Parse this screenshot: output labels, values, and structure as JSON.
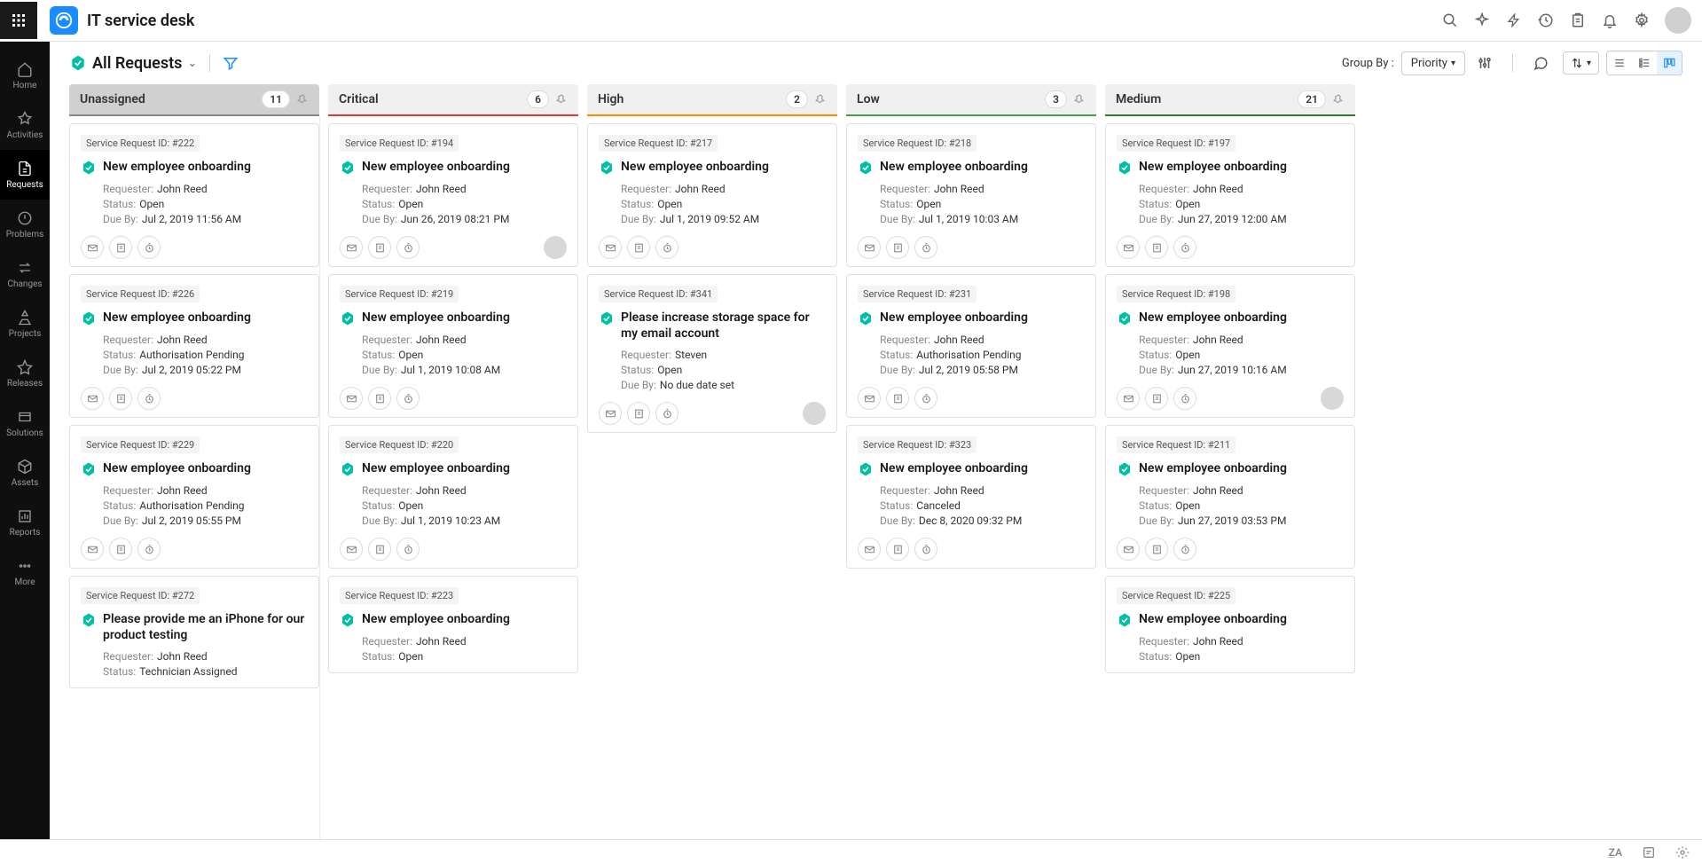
{
  "app_title": "IT service desk",
  "nav": [
    {
      "label": "Home"
    },
    {
      "label": "Activities"
    },
    {
      "label": "Requests"
    },
    {
      "label": "Problems"
    },
    {
      "label": "Changes"
    },
    {
      "label": "Projects"
    },
    {
      "label": "Releases"
    },
    {
      "label": "Solutions"
    },
    {
      "label": "Assets"
    },
    {
      "label": "Reports"
    },
    {
      "label": "More"
    }
  ],
  "active_nav": 2,
  "toolbar": {
    "view_title": "All Requests",
    "group_by_label": "Group By :",
    "group_by_value": "Priority"
  },
  "labels": {
    "id_prefix": "Service Request ID: #",
    "requester": "Requester:",
    "status": "Status:",
    "due_by": "Due By:"
  },
  "columns": [
    {
      "key": "unassigned",
      "title": "Unassigned",
      "count": "11",
      "cls": "col-unassigned",
      "cards": [
        {
          "id": "222",
          "title": "New employee onboarding",
          "requester": "John Reed",
          "status": "Open",
          "due": "Jul 2, 2019 11:56 AM",
          "assignee": false
        },
        {
          "id": "226",
          "title": "New employee onboarding",
          "requester": "John Reed",
          "status": "Authorisation Pending",
          "due": "Jul 2, 2019 05:22 PM",
          "assignee": false
        },
        {
          "id": "229",
          "title": "New employee onboarding",
          "requester": "John Reed",
          "status": "Authorisation Pending",
          "due": "Jul 2, 2019 05:55 PM",
          "assignee": false
        },
        {
          "id": "272",
          "title": "Please provide me an iPhone for our product testing",
          "requester": "John Reed",
          "status": "Technician Assigned",
          "due": "",
          "assignee": false,
          "partial": true
        }
      ]
    },
    {
      "key": "critical",
      "title": "Critical",
      "count": "6",
      "cls": "col-critical",
      "cards": [
        {
          "id": "194",
          "title": "New employee onboarding",
          "requester": "John Reed",
          "status": "Open",
          "due": "Jun 26, 2019 08:21 PM",
          "assignee": true
        },
        {
          "id": "219",
          "title": "New employee onboarding",
          "requester": "John Reed",
          "status": "Open",
          "due": "Jul 1, 2019 10:08 AM",
          "assignee": false
        },
        {
          "id": "220",
          "title": "New employee onboarding",
          "requester": "John Reed",
          "status": "Open",
          "due": "Jul 1, 2019 10:23 AM",
          "assignee": false
        },
        {
          "id": "223",
          "title": "New employee onboarding",
          "requester": "John Reed",
          "status": "Open",
          "due": "",
          "assignee": false,
          "partial": true
        }
      ]
    },
    {
      "key": "high",
      "title": "High",
      "count": "2",
      "cls": "col-high",
      "cards": [
        {
          "id": "217",
          "title": "New employee onboarding",
          "requester": "John Reed",
          "status": "Open",
          "due": "Jul 1, 2019 09:52 AM",
          "assignee": false
        },
        {
          "id": "341",
          "title": "Please increase storage space for my email account",
          "requester": "Steven",
          "status": "Open",
          "due": "No due date set",
          "assignee": true
        }
      ]
    },
    {
      "key": "low",
      "title": "Low",
      "count": "3",
      "cls": "col-low",
      "cards": [
        {
          "id": "218",
          "title": "New employee onboarding",
          "requester": "John Reed",
          "status": "Open",
          "due": "Jul 1, 2019 10:03 AM",
          "assignee": false
        },
        {
          "id": "231",
          "title": "New employee onboarding",
          "requester": "John Reed",
          "status": "Authorisation Pending",
          "due": "Jul 2, 2019 05:58 PM",
          "assignee": false
        },
        {
          "id": "323",
          "title": "New employee onboarding",
          "requester": "John Reed",
          "status": "Canceled",
          "due": "Dec 8, 2020 09:32 PM",
          "assignee": false
        }
      ]
    },
    {
      "key": "medium",
      "title": "Medium",
      "count": "21",
      "cls": "col-medium",
      "cards": [
        {
          "id": "197",
          "title": "New employee onboarding",
          "requester": "John Reed",
          "status": "Open",
          "due": "Jun 27, 2019 12:00 AM",
          "assignee": false
        },
        {
          "id": "198",
          "title": "New employee onboarding",
          "requester": "John Reed",
          "status": "Open",
          "due": "Jun 27, 2019 10:16 AM",
          "assignee": true
        },
        {
          "id": "211",
          "title": "New employee onboarding",
          "requester": "John Reed",
          "status": "Open",
          "due": "Jun 27, 2019 03:53 PM",
          "assignee": false
        },
        {
          "id": "225",
          "title": "New employee onboarding",
          "requester": "John Reed",
          "status": "Open",
          "due": "",
          "assignee": false,
          "partial": true
        }
      ]
    }
  ]
}
